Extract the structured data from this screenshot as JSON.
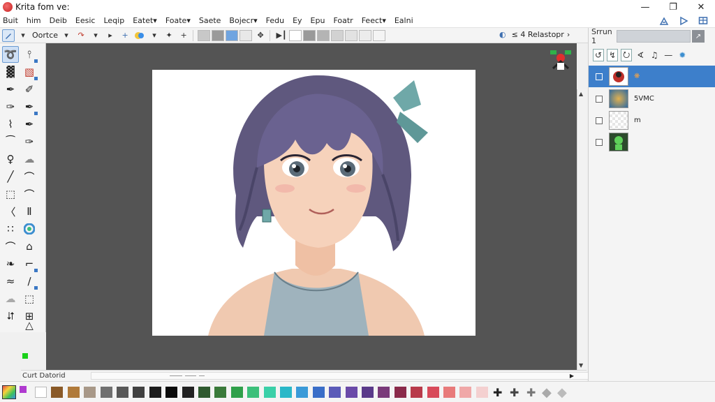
{
  "window": {
    "title": "Krita fom ve:",
    "minimize_glyph": "—",
    "maximize_glyph": "❐",
    "close_glyph": "✕"
  },
  "menu": {
    "items": [
      "Buit",
      "him",
      "Deib",
      "Eesic",
      "Leqip",
      "Eatet▾",
      "Foate▾",
      "Saete",
      "Bojecr▾",
      "Fedu",
      "Ey",
      "Epu",
      "Foatr",
      "Feect▾",
      "Ealni"
    ],
    "right_icons": [
      "brush-preset-icon",
      "play-icon",
      "workspace-icon"
    ]
  },
  "tool_options": {
    "brush_label": "Oortce",
    "zoom_label": "≤ 4 Relastopr",
    "swatches_left": [
      "#c8c8c8",
      "#9a9a9a",
      "#6fa4e0",
      "#e8e8e8"
    ],
    "swatches_right": [
      "#ffffff",
      "#9a9a9a",
      "#b4b4b4",
      "#d2d2d2",
      "#e2e2e2",
      "#ececec",
      "#f4f4f4"
    ]
  },
  "status": {
    "text": "Curt Datorid"
  },
  "docker": {
    "label": "Srrun 1",
    "tabs": [
      "↺",
      "↯",
      "⭮",
      "∢",
      "♫",
      "—",
      "✹"
    ],
    "layers": [
      {
        "name": "❋",
        "selected": true
      },
      {
        "name": "5VMC",
        "selected": false
      },
      {
        "name": "m",
        "selected": false
      },
      {
        "name": "",
        "selected": false
      }
    ]
  },
  "palette": {
    "colors": [
      "#ffffff",
      "#8a5a28",
      "#b07a3a",
      "#a89888",
      "#707070",
      "#585858",
      "#404040",
      "#1c1c1c",
      "#0a0a0a",
      "#222222",
      "#2f5a2f",
      "#3a7a3a",
      "#2fa04a",
      "#3cc07a",
      "#3ad0a8",
      "#2ab8c8",
      "#3a9ad8",
      "#3a6ec8",
      "#5a5ab8",
      "#6a4aa8",
      "#5a3a8a",
      "#7a3a7a",
      "#8a2a4a",
      "#b83a4a",
      "#d84a5a",
      "#e87a7a",
      "#f0a8a8",
      "#f4d0d0"
    ]
  },
  "colors": {
    "accent": "#3d7fcb",
    "canvas_bg": "#545454",
    "selected_layer_text": "#f6a445"
  }
}
